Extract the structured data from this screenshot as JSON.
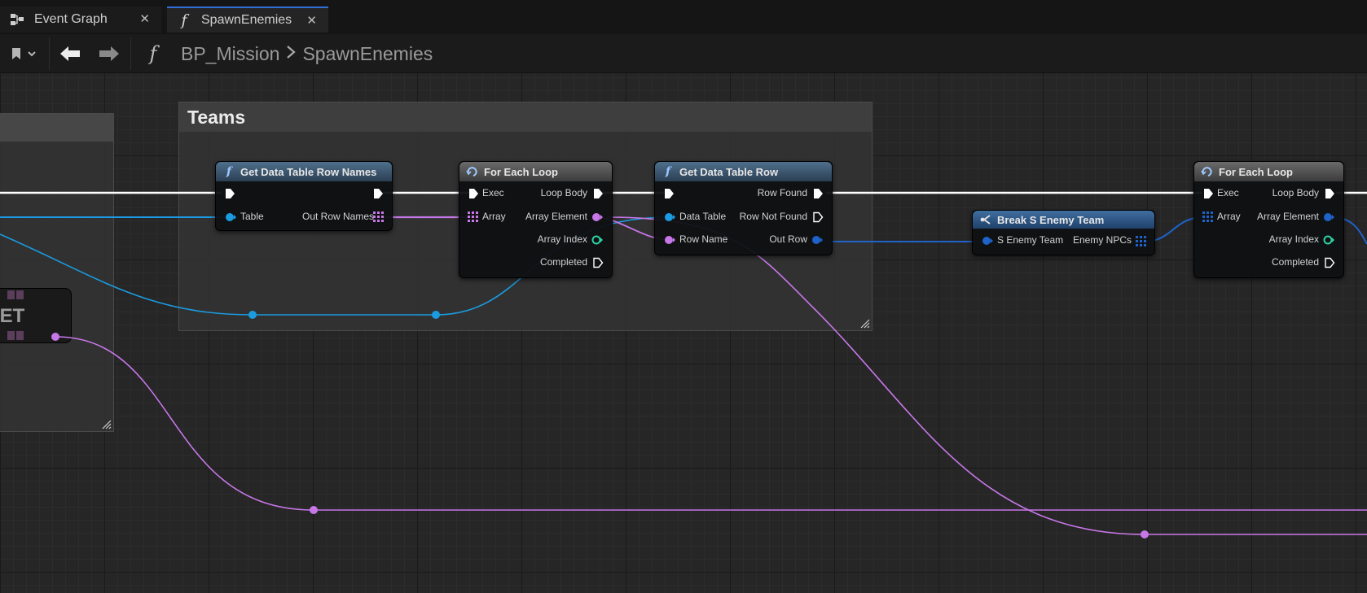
{
  "tabs": [
    {
      "label": "Event Graph",
      "icon": "event-graph-icon",
      "active": false
    },
    {
      "label": "SpawnEnemies",
      "icon": "function-icon",
      "active": true
    }
  ],
  "toolbar": {
    "breadcrumb": [
      "BP_Mission",
      "SpawnEnemies"
    ]
  },
  "comments": {
    "teams": "Teams"
  },
  "nodes": {
    "get_row_names": {
      "title": "Get Data Table Row Names",
      "pins_in": [
        "Table"
      ],
      "pins_out": [
        "Out Row Names"
      ]
    },
    "for_each_1": {
      "title": "For Each Loop",
      "pins_in": [
        "Exec",
        "Array"
      ],
      "pins_out": [
        "Loop Body",
        "Array Element",
        "Array Index",
        "Completed"
      ]
    },
    "get_row": {
      "title": "Get Data Table Row",
      "pins_in": [
        "Data Table",
        "Row Name"
      ],
      "pins_out": [
        "Row Found",
        "Row Not Found",
        "Out Row"
      ]
    },
    "break_team": {
      "title": "Break S Enemy Team",
      "pins_in": [
        "S Enemy Team"
      ],
      "pins_out": [
        "Enemy NPCs"
      ]
    },
    "for_each_2": {
      "title": "For Each Loop",
      "pins_in": [
        "Exec",
        "Array"
      ],
      "pins_out": [
        "Loop Body",
        "Array Element",
        "Array Index",
        "Completed"
      ]
    },
    "get_partial": {
      "title": "GET"
    }
  },
  "colors": {
    "exec": "#ffffff",
    "object": "#1b9be0",
    "name": "#c777e8",
    "struct": "#1f62c9",
    "int": "#2fd1a3",
    "accent_tab": "#2f6fd6"
  }
}
